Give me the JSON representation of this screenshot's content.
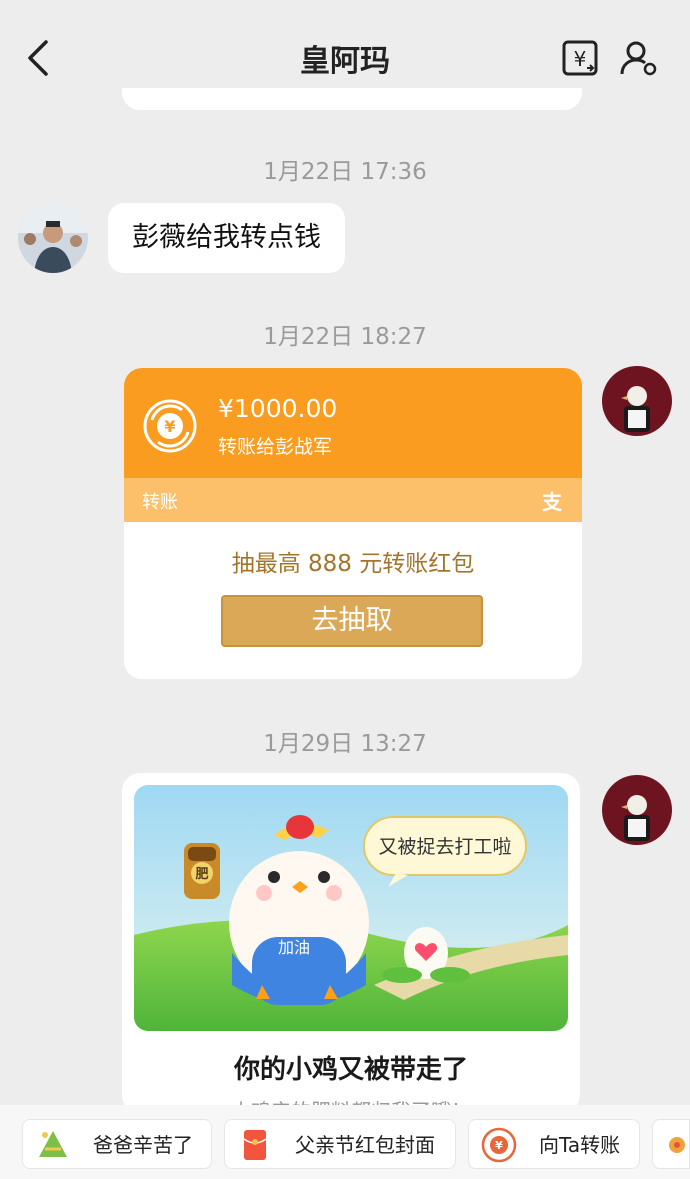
{
  "header": {
    "title": "皇阿玛"
  },
  "messages": {
    "time1": "1月22日 17:36",
    "text1": "彭薇给我转点钱",
    "time2": "1月22日 18:27",
    "time3": "1月29日 13:27"
  },
  "transfer": {
    "amount": "¥1000.00",
    "to": "转账给彭战军",
    "label": "转账",
    "brand_glyph": "支",
    "promo": "抽最高 888 元转账红包",
    "button": "去抽取"
  },
  "game_card": {
    "speech": "又被捉去打工啦",
    "bag_label": "肥",
    "apron_label": "加油",
    "title": "你的小鸡又被带走了",
    "subtitle": "小鸡产的肥料都归我了哦！"
  },
  "quick_actions": [
    {
      "label": "爸爸辛苦了"
    },
    {
      "label": "父亲节红包封面"
    },
    {
      "label": "向Ta转账"
    }
  ],
  "colors": {
    "transfer_orange": "#fa9c1f",
    "transfer_bar": "#fcc06a",
    "button_gold": "#dba857"
  }
}
